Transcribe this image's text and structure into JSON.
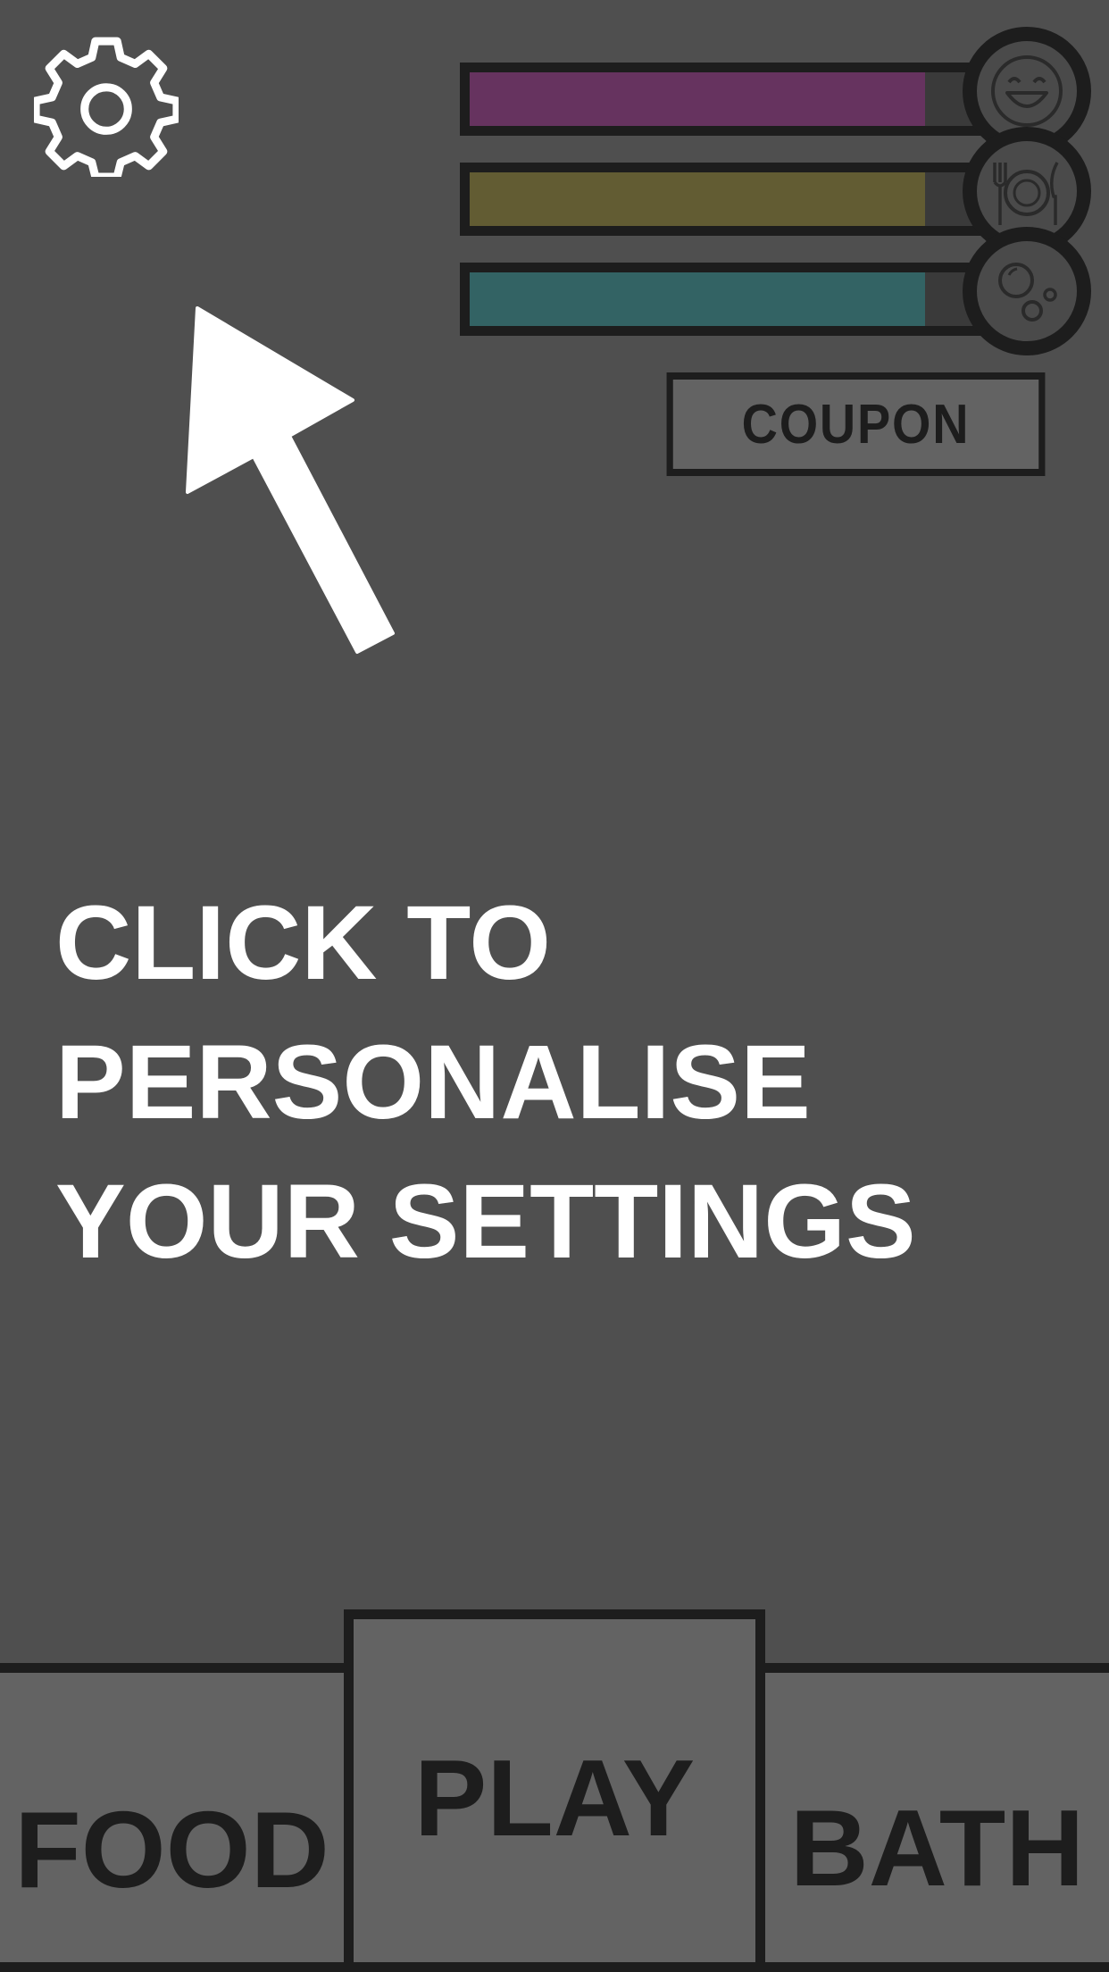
{
  "settings": {
    "icon": "gear-icon"
  },
  "stats": [
    {
      "name": "happiness",
      "icon": "smiley-face-icon",
      "level": 0.85,
      "color": "#66335f"
    },
    {
      "name": "hunger",
      "icon": "plate-cutlery-icon",
      "level": 0.85,
      "color": "#625c33"
    },
    {
      "name": "hygiene",
      "icon": "bubbles-icon",
      "level": 0.85,
      "color": "#336364"
    }
  ],
  "coupon": {
    "label": "COUPON"
  },
  "hint": {
    "line1": "CLICK TO",
    "line2": "PERSONALISE",
    "line3": "YOUR SETTINGS"
  },
  "tabs": {
    "food": "FOOD",
    "play": "PLAY",
    "bath": "BATH"
  },
  "colors": {
    "background": "#4f4f4f",
    "outline": "#1d1d1d",
    "panel": "#636363",
    "text_light": "#ffffff"
  }
}
